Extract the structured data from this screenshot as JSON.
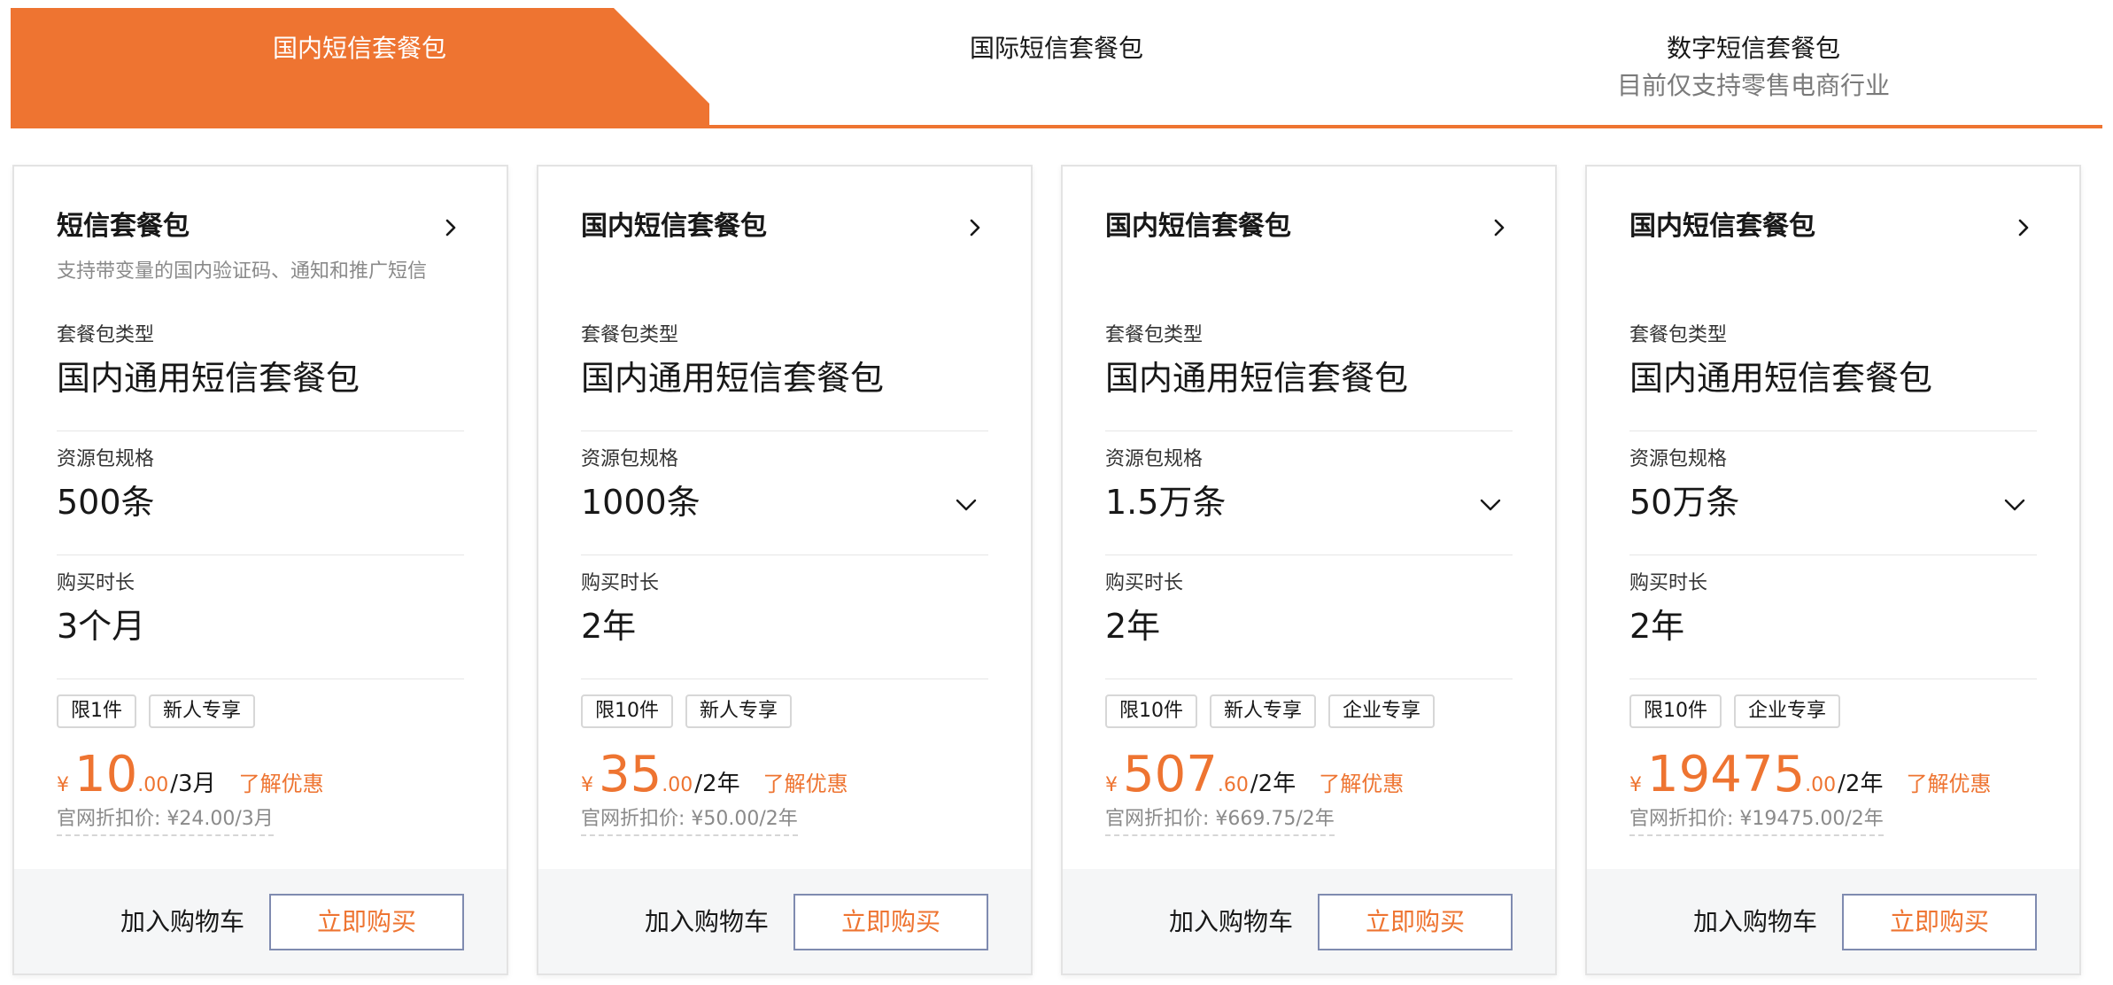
{
  "colors": {
    "accent": "#ee7431",
    "border": "#e3e3e3",
    "button_border": "#7f8bb0",
    "footer_bg": "#f5f6f7"
  },
  "tabs": [
    {
      "label": "国内短信套餐包",
      "sub": ""
    },
    {
      "label": "国际短信套餐包",
      "sub": ""
    },
    {
      "label": "数字短信套餐包",
      "sub": "目前仅支持零售电商行业"
    }
  ],
  "cards": [
    {
      "title": "短信套餐包",
      "desc": "支持带变量的国内验证码、通知和推广短信",
      "type_label": "套餐包类型",
      "type_value": "国内通用短信套餐包",
      "spec_label": "资源包规格",
      "spec_value": "500条",
      "duration_label": "购买时长",
      "duration_value": "3个月",
      "tags": [
        "限1件",
        "新人专享"
      ],
      "currency": "¥",
      "price_int": "10",
      "price_dec": ".00",
      "price_unit": "/3月",
      "promo": "了解优惠",
      "orig_price": "官网折扣价: ¥24.00/3月",
      "cart_label": "加入购物车",
      "buy_label": "立即购买"
    },
    {
      "title": "国内短信套餐包",
      "desc": "",
      "type_label": "套餐包类型",
      "type_value": "国内通用短信套餐包",
      "spec_label": "资源包规格",
      "spec_value": "1000条",
      "duration_label": "购买时长",
      "duration_value": "2年",
      "tags": [
        "限10件",
        "新人专享"
      ],
      "currency": "¥",
      "price_int": "35",
      "price_dec": ".00",
      "price_unit": "/2年",
      "promo": "了解优惠",
      "orig_price": "官网折扣价: ¥50.00/2年",
      "cart_label": "加入购物车",
      "buy_label": "立即购买"
    },
    {
      "title": "国内短信套餐包",
      "desc": "",
      "type_label": "套餐包类型",
      "type_value": "国内通用短信套餐包",
      "spec_label": "资源包规格",
      "spec_value": "1.5万条",
      "duration_label": "购买时长",
      "duration_value": "2年",
      "tags": [
        "限10件",
        "新人专享",
        "企业专享"
      ],
      "currency": "¥",
      "price_int": "507",
      "price_dec": ".60",
      "price_unit": "/2年",
      "promo": "了解优惠",
      "orig_price": "官网折扣价: ¥669.75/2年",
      "cart_label": "加入购物车",
      "buy_label": "立即购买"
    },
    {
      "title": "国内短信套餐包",
      "desc": "",
      "type_label": "套餐包类型",
      "type_value": "国内通用短信套餐包",
      "spec_label": "资源包规格",
      "spec_value": "50万条",
      "duration_label": "购买时长",
      "duration_value": "2年",
      "tags": [
        "限10件",
        "企业专享"
      ],
      "currency": "¥",
      "price_int": "19475",
      "price_dec": ".00",
      "price_unit": "/2年",
      "promo": "了解优惠",
      "orig_price": "官网折扣价: ¥19475.00/2年",
      "cart_label": "加入购物车",
      "buy_label": "立即购买"
    }
  ]
}
